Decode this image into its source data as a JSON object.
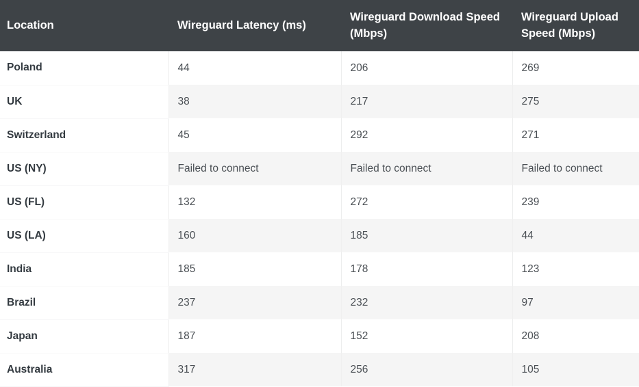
{
  "table": {
    "columns": [
      "Location",
      "Wireguard Latency (ms)",
      "Wireguard Download Speed (Mbps)",
      "Wireguard Upload Speed (Mbps)"
    ],
    "colors": {
      "header_background": "#3e4347",
      "header_text": "#ffffff",
      "row_stripe": "#f5f5f5",
      "row_base": "#ffffff",
      "body_text": "#4b5055",
      "location_text": "#333a40",
      "divider": "#eceded"
    },
    "rows": [
      {
        "location": "Poland",
        "latency": "44",
        "download": "206",
        "upload": "269"
      },
      {
        "location": "UK",
        "latency": "38",
        "download": "217",
        "upload": "275"
      },
      {
        "location": "Switzerland",
        "latency": "45",
        "download": "292",
        "upload": "271"
      },
      {
        "location": "US (NY)",
        "latency": "Failed to connect",
        "download": "Failed to connect",
        "upload": "Failed to connect"
      },
      {
        "location": "US (FL)",
        "latency": "132",
        "download": "272",
        "upload": "239"
      },
      {
        "location": "US (LA)",
        "latency": "160",
        "download": "185",
        "upload": "44"
      },
      {
        "location": "India",
        "latency": "185",
        "download": "178",
        "upload": "123"
      },
      {
        "location": "Brazil",
        "latency": "237",
        "download": "232",
        "upload": "97"
      },
      {
        "location": "Japan",
        "latency": "187",
        "download": "152",
        "upload": "208"
      },
      {
        "location": "Australia",
        "latency": "317",
        "download": "256",
        "upload": "105"
      }
    ]
  }
}
